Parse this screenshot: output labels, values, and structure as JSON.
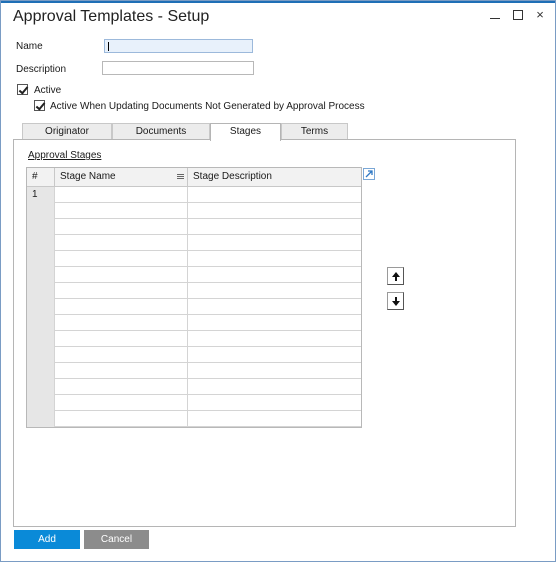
{
  "window": {
    "title": "Approval Templates - Setup",
    "controls": {
      "minimize": "minimize",
      "maximize": "maximize",
      "close": "×"
    }
  },
  "form": {
    "name_label": "Name",
    "name_value": "",
    "description_label": "Description",
    "description_value": ""
  },
  "options": {
    "active_label": "Active",
    "active_checked": true,
    "active_when_updating_label": "Active When Updating Documents Not Generated by Approval Process",
    "active_when_updating_checked": true
  },
  "tabs": [
    {
      "label": "Originator",
      "active": false
    },
    {
      "label": "Documents",
      "active": false
    },
    {
      "label": "Stages",
      "active": true
    },
    {
      "label": "Terms",
      "active": false
    }
  ],
  "stages": {
    "section_title": "Approval Stages",
    "columns": [
      "#",
      "Stage Name",
      "Stage Description"
    ],
    "rows": [
      {
        "num": "1",
        "name": "",
        "desc": ""
      },
      {
        "num": "",
        "name": "",
        "desc": ""
      },
      {
        "num": "",
        "name": "",
        "desc": ""
      },
      {
        "num": "",
        "name": "",
        "desc": ""
      },
      {
        "num": "",
        "name": "",
        "desc": ""
      },
      {
        "num": "",
        "name": "",
        "desc": ""
      },
      {
        "num": "",
        "name": "",
        "desc": ""
      },
      {
        "num": "",
        "name": "",
        "desc": ""
      },
      {
        "num": "",
        "name": "",
        "desc": ""
      },
      {
        "num": "",
        "name": "",
        "desc": ""
      },
      {
        "num": "",
        "name": "",
        "desc": ""
      },
      {
        "num": "",
        "name": "",
        "desc": ""
      },
      {
        "num": "",
        "name": "",
        "desc": ""
      },
      {
        "num": "",
        "name": "",
        "desc": ""
      },
      {
        "num": "",
        "name": "",
        "desc": ""
      }
    ],
    "icons": {
      "expand": "expand-icon",
      "move_up": "arrow-up-icon",
      "move_down": "arrow-down-icon",
      "column_menu": "menu-icon"
    }
  },
  "footer": {
    "add_label": "Add",
    "cancel_label": "Cancel"
  },
  "colors": {
    "accent": "#0a8ad8",
    "cancel": "#8c8c8c",
    "title_bar_line": "#1f6fb6"
  }
}
